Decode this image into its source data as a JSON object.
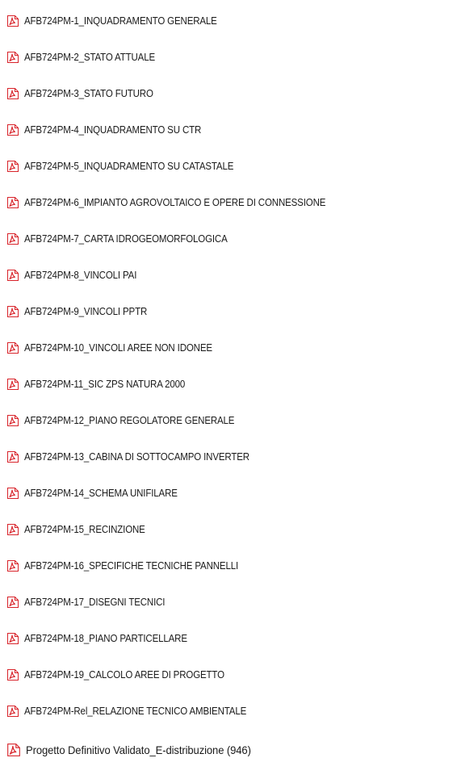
{
  "files": [
    {
      "label": "AFB724PM-1_INQUADRAMENTO GENERALE",
      "icon": "pdf-icon"
    },
    {
      "label": "AFB724PM-2_STATO ATTUALE",
      "icon": "pdf-icon"
    },
    {
      "label": "AFB724PM-3_STATO FUTURO",
      "icon": "pdf-icon"
    },
    {
      "label": "AFB724PM-4_INQUADRAMENTO SU CTR",
      "icon": "pdf-icon"
    },
    {
      "label": "AFB724PM-5_INQUADRAMENTO SU CATASTALE",
      "icon": "pdf-icon"
    },
    {
      "label": "AFB724PM-6_IMPIANTO AGROVOLTAICO E OPERE DI CONNESSIONE",
      "icon": "pdf-icon"
    },
    {
      "label": "AFB724PM-7_CARTA IDROGEOMORFOLOGICA",
      "icon": "pdf-icon"
    },
    {
      "label": "AFB724PM-8_VINCOLI PAI",
      "icon": "pdf-icon"
    },
    {
      "label": "AFB724PM-9_VINCOLI PPTR",
      "icon": "pdf-icon"
    },
    {
      "label": "AFB724PM-10_VINCOLI AREE NON IDONEE",
      "icon": "pdf-icon"
    },
    {
      "label": "AFB724PM-11_SIC ZPS NATURA 2000",
      "icon": "pdf-icon"
    },
    {
      "label": "AFB724PM-12_PIANO REGOLATORE GENERALE",
      "icon": "pdf-icon"
    },
    {
      "label": "AFB724PM-13_CABINA DI SOTTOCAMPO INVERTER",
      "icon": "pdf-icon"
    },
    {
      "label": "AFB724PM-14_SCHEMA UNIFILARE",
      "icon": "pdf-icon"
    },
    {
      "label": "AFB724PM-15_RECINZIONE",
      "icon": "pdf-icon"
    },
    {
      "label": "AFB724PM-16_SPECIFICHE TECNICHE PANNELLI",
      "icon": "pdf-icon"
    },
    {
      "label": "AFB724PM-17_DISEGNI TECNICI",
      "icon": "pdf-icon"
    },
    {
      "label": "AFB724PM-18_PIANO PARTICELLARE",
      "icon": "pdf-icon"
    },
    {
      "label": "AFB724PM-19_CALCOLO AREE DI PROGETTO",
      "icon": "pdf-icon"
    },
    {
      "label": "AFB724PM-Rel_RELAZIONE TECNICO AMBIENTALE",
      "icon": "pdf-icon"
    },
    {
      "label": "Progetto Definitivo Validato_E-distribuzione (946)",
      "icon": "pdf-icon"
    }
  ],
  "colors": {
    "icon_red": "#d8232a",
    "text": "#1a1a1a",
    "background": "#ffffff"
  }
}
